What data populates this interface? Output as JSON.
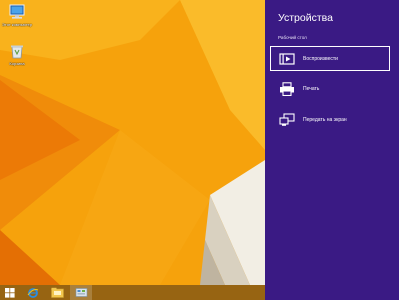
{
  "desktop": {
    "icons": [
      {
        "label": "Этот компьютер",
        "icon": "computer-icon"
      },
      {
        "label": "Корзина",
        "icon": "recycle-bin-icon"
      }
    ]
  },
  "taskbar": {
    "items": [
      {
        "icon": "windows-start-icon"
      },
      {
        "icon": "internet-explorer-icon"
      },
      {
        "icon": "file-explorer-icon"
      },
      {
        "icon": "control-panel-icon",
        "active": true
      }
    ]
  },
  "charm": {
    "title": "Устройства",
    "section_label": "Рабочий стол",
    "devices": [
      {
        "label": "Воспроизвести",
        "icon": "play-to-icon",
        "selected": true
      },
      {
        "label": "Печать",
        "icon": "printer-icon"
      },
      {
        "label": "Передать на экран",
        "icon": "project-icon"
      }
    ]
  },
  "colors": {
    "charm_background": "#3a1a84",
    "desktop_orange": "#f4a60c"
  }
}
